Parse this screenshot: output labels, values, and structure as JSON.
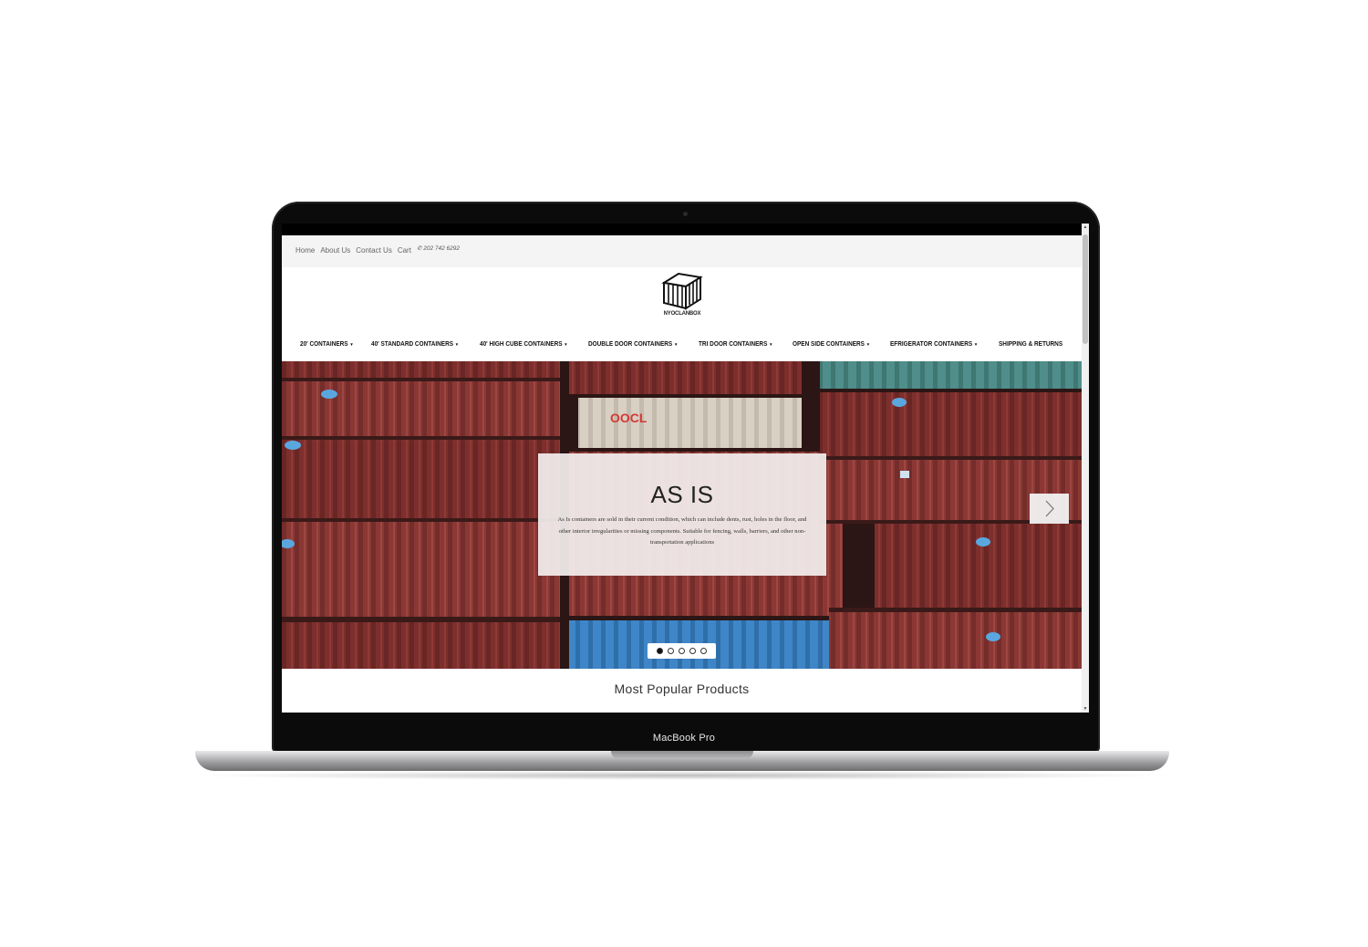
{
  "device": {
    "model_label": "MacBook Pro"
  },
  "top_links": [
    {
      "label": "Home"
    },
    {
      "label": "About Us"
    },
    {
      "label": "Contact Us"
    },
    {
      "label": "Cart"
    }
  ],
  "phone": "✆ 202 742 6292",
  "logo_text": "NYOCLANBOX",
  "nav": [
    {
      "label": "20' CONTAINERS",
      "has_dropdown": true
    },
    {
      "label": "40' STANDARD CONTAINERS",
      "has_dropdown": true
    },
    {
      "label": "40' HIGH CUBE CONTAINERS",
      "has_dropdown": true
    },
    {
      "label": "DOUBLE DOOR CONTAINERS",
      "has_dropdown": true
    },
    {
      "label": "TRI DOOR CONTAINERS",
      "has_dropdown": true
    },
    {
      "label": "OPEN SIDE CONTAINERS",
      "has_dropdown": true
    },
    {
      "label": "EFRIGERATOR CONTAINERS",
      "has_dropdown": true
    },
    {
      "label": "SHIPPING & RETURNS",
      "has_dropdown": false
    }
  ],
  "caret": "▾",
  "hero": {
    "title": "AS IS",
    "description": "As Is containers are sold in their current condition, which can include dents, rust, holes in the floor, and other interior irregularities or missing components. Suitable for fencing, walls, barriers, and other non-transportation applications",
    "container_logo_text": "OOCL",
    "slide_count": 5,
    "active_slide": 1
  },
  "section_title": "Most Popular Products",
  "icons": {
    "next": "chevron-right-icon",
    "logo": "shipping-container-logo"
  },
  "colors": {
    "container_red": "#7d2f2d",
    "container_blue": "#3f86c8",
    "container_teal": "#4f8e8a",
    "accent": "#111111"
  }
}
